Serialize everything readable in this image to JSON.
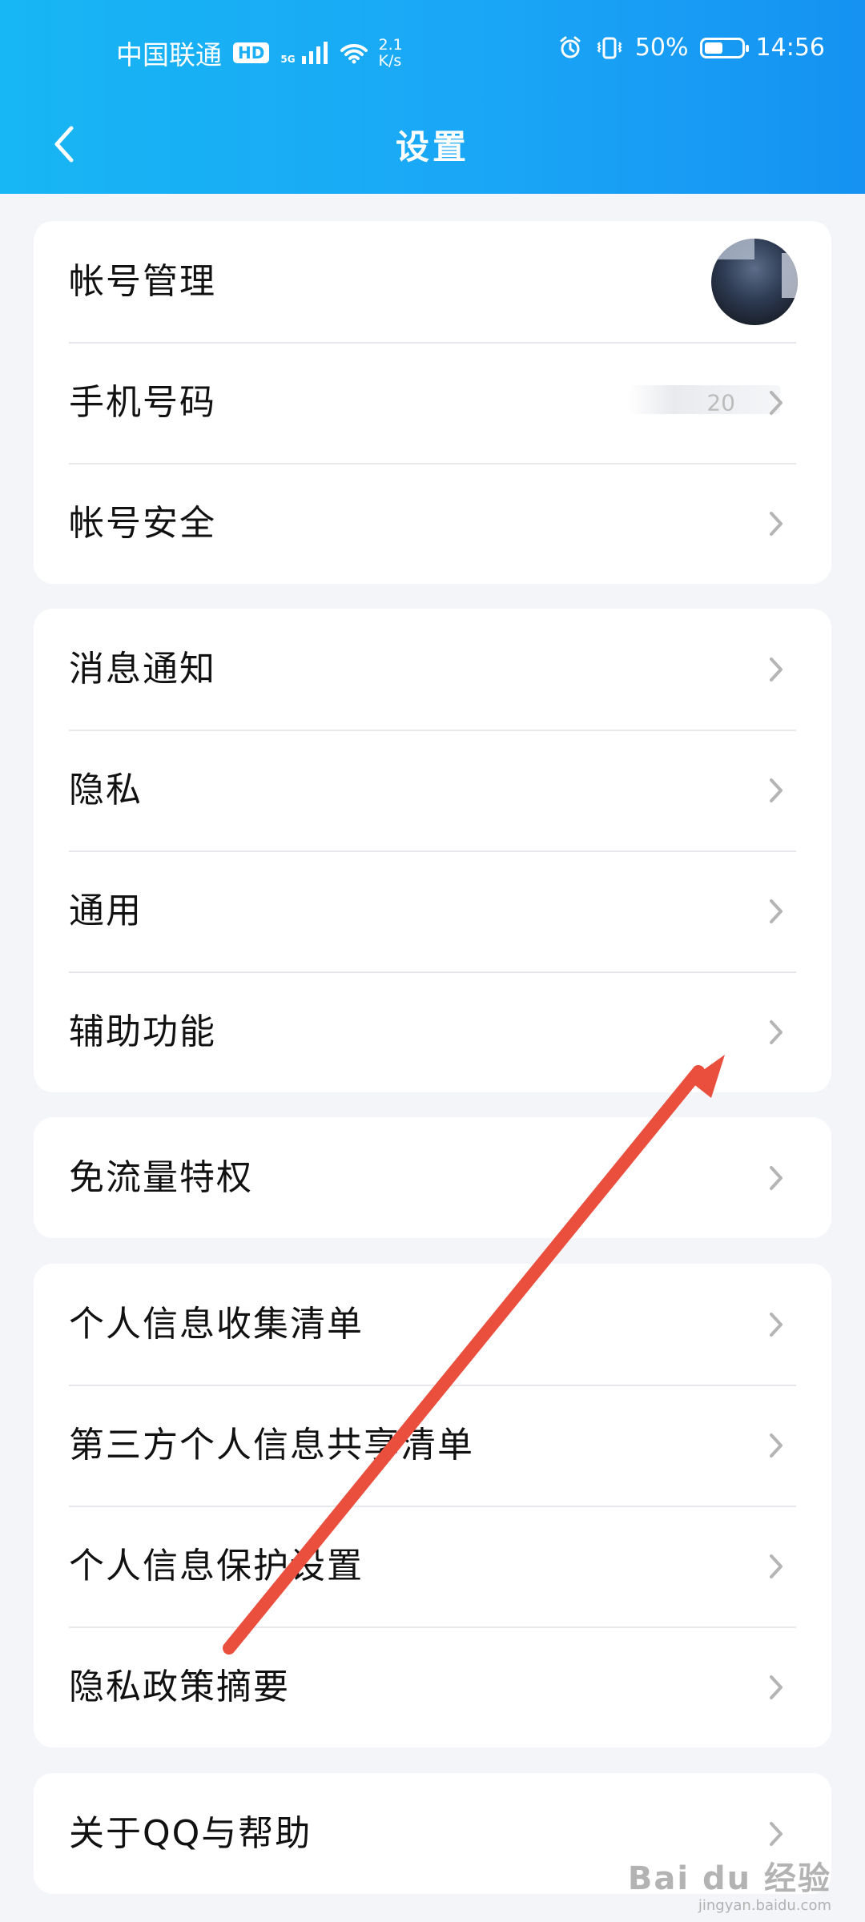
{
  "status_bar": {
    "carrier": "中国联通",
    "network_badge": "HD",
    "signal_label": "5G",
    "speed_value": "2.1",
    "speed_unit": "K/s",
    "battery_text": "50%",
    "time": "14:56"
  },
  "header": {
    "title": "设置",
    "back_icon": "chevron-left-icon"
  },
  "sections": [
    {
      "items": [
        {
          "label": "帐号管理",
          "value": "",
          "trailing": "avatar"
        },
        {
          "label": "手机号码",
          "value": "20",
          "trailing": "chevron-right-icon"
        },
        {
          "label": "帐号安全",
          "value": "",
          "trailing": "chevron-right-icon"
        }
      ]
    },
    {
      "items": [
        {
          "label": "消息通知",
          "trailing": "chevron-right-icon"
        },
        {
          "label": "隐私",
          "trailing": "chevron-right-icon"
        },
        {
          "label": "通用",
          "trailing": "chevron-right-icon"
        },
        {
          "label": "辅助功能",
          "trailing": "chevron-right-icon"
        }
      ]
    },
    {
      "items": [
        {
          "label": "免流量特权",
          "trailing": "chevron-right-icon"
        }
      ]
    },
    {
      "items": [
        {
          "label": "个人信息收集清单",
          "trailing": "chevron-right-icon"
        },
        {
          "label": "第三方个人信息共享清单",
          "trailing": "chevron-right-icon"
        },
        {
          "label": "个人信息保护设置",
          "trailing": "chevron-right-icon"
        },
        {
          "label": "隐私政策摘要",
          "trailing": "chevron-right-icon"
        }
      ]
    },
    {
      "items": [
        {
          "label": "关于QQ与帮助",
          "trailing": "chevron-right-icon"
        }
      ]
    }
  ],
  "annotation": {
    "type": "arrow",
    "color": "#ea4f3e",
    "target": "辅助功能"
  },
  "watermark": {
    "brand": "Bai du 经验",
    "url": "jingyan.baidu.com"
  }
}
